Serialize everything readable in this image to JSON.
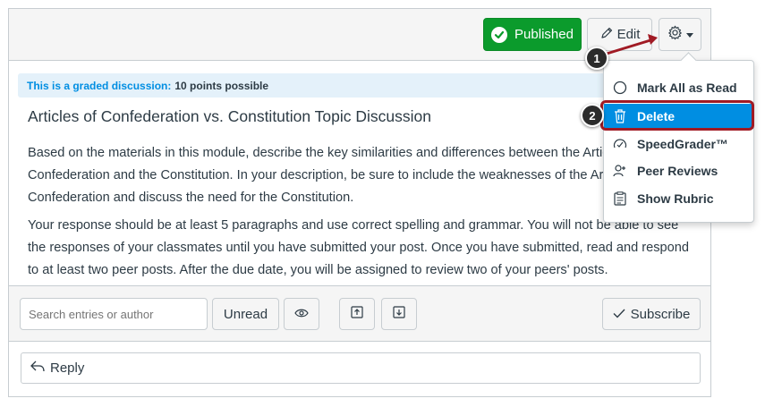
{
  "header": {
    "published_label": "Published",
    "edit_label": "Edit"
  },
  "discussion": {
    "graded_label": "This is a graded discussion:",
    "points": "10 points possible",
    "title": "Articles of Confederation vs. Constitution Topic Discussion",
    "paragraph1": "Based on the materials in this module, describe the key similarities and differences between the Articles of Confederation and the Constitution. In your description, be sure to include the weaknesses of the Articles of Confederation and discuss the need for the Constitution.",
    "paragraph2": "Your response should be at least 5 paragraphs and use correct spelling and grammar. You will not be able to see the responses of your classmates until you have submitted your post. Once you have submitted, read and respond to at least two peer posts. After the due date, you will be assigned to review two of your peers' posts."
  },
  "toolbar": {
    "search_placeholder": "Search entries or author",
    "unread_label": "Unread",
    "subscribe_label": "Subscribe"
  },
  "reply": {
    "label": "Reply"
  },
  "menu": {
    "items": [
      {
        "label": "Mark All as Read",
        "icon": "circle-icon"
      },
      {
        "label": "Delete",
        "icon": "trash-icon"
      },
      {
        "label": "SpeedGrader™",
        "icon": "speedgrader-icon"
      },
      {
        "label": "Peer Reviews",
        "icon": "peer-review-icon"
      },
      {
        "label": "Show Rubric",
        "icon": "rubric-icon"
      }
    ]
  },
  "callouts": [
    "1",
    "2"
  ],
  "colors": {
    "published": "#0b9b2c",
    "accent": "#008ee2",
    "highlight_outline": "#a01a24"
  }
}
